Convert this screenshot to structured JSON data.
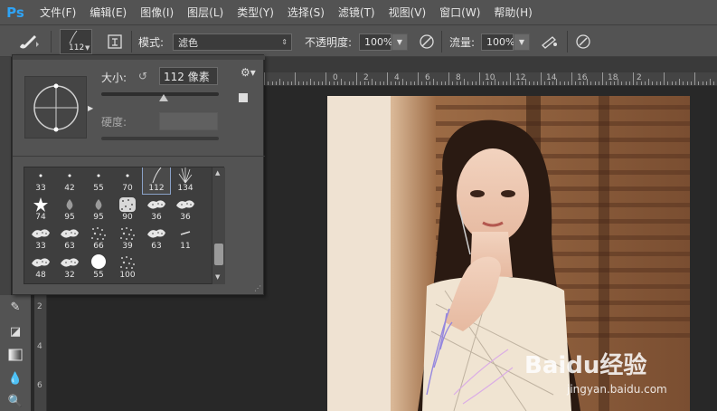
{
  "app": {
    "logo": "Ps"
  },
  "menu": [
    "文件(F)",
    "编辑(E)",
    "图像(I)",
    "图层(L)",
    "类型(Y)",
    "选择(S)",
    "滤镜(T)",
    "视图(V)",
    "窗口(W)",
    "帮助(H)"
  ],
  "options": {
    "brush_size": "112",
    "mode_label": "模式:",
    "mode_value": "滤色",
    "opacity_label": "不透明度:",
    "opacity_value": "100%",
    "flow_label": "流量:",
    "flow_value": "100%"
  },
  "brush_panel": {
    "size_label": "大小:",
    "size_value": "112 像素",
    "size_slider_fraction": 0.53,
    "hardness_label": "硬度:",
    "hardness_value": "",
    "brushes": [
      {
        "size": "33",
        "shape": "dot-small"
      },
      {
        "size": "42",
        "shape": "dot-small"
      },
      {
        "size": "55",
        "shape": "dot-small"
      },
      {
        "size": "70",
        "shape": "dot-small"
      },
      {
        "size": "112",
        "shape": "stroke-curve",
        "selected": true
      },
      {
        "size": "134",
        "shape": "grass"
      },
      {
        "size": "74",
        "shape": "star"
      },
      {
        "size": "95",
        "shape": "drop"
      },
      {
        "size": "95",
        "shape": "drop"
      },
      {
        "size": "90",
        "shape": "texture"
      },
      {
        "size": "36",
        "shape": "splatter"
      },
      {
        "size": "36",
        "shape": "splatter"
      },
      {
        "size": "33",
        "shape": "splatter"
      },
      {
        "size": "63",
        "shape": "splatter"
      },
      {
        "size": "66",
        "shape": "scatter"
      },
      {
        "size": "39",
        "shape": "scatter"
      },
      {
        "size": "63",
        "shape": "splatter"
      },
      {
        "size": "11",
        "shape": "dash"
      },
      {
        "size": "48",
        "shape": "splatter"
      },
      {
        "size": "32",
        "shape": "splatter"
      },
      {
        "size": "55",
        "shape": "circle-hard"
      },
      {
        "size": "100",
        "shape": "scatter"
      }
    ]
  },
  "ruler": {
    "top_ticks": [
      "0",
      "2",
      "4",
      "6",
      "8",
      "10",
      "12",
      "14",
      "16",
      "18",
      "2"
    ],
    "left_ticks": [
      "2",
      "4",
      "6"
    ]
  },
  "colors": {
    "accent": "#2fa3f5",
    "panel": "#535353",
    "bg": "#282828"
  },
  "watermark": {
    "site": "jingyan.baidu.com",
    "brand": "Baidu经验"
  }
}
